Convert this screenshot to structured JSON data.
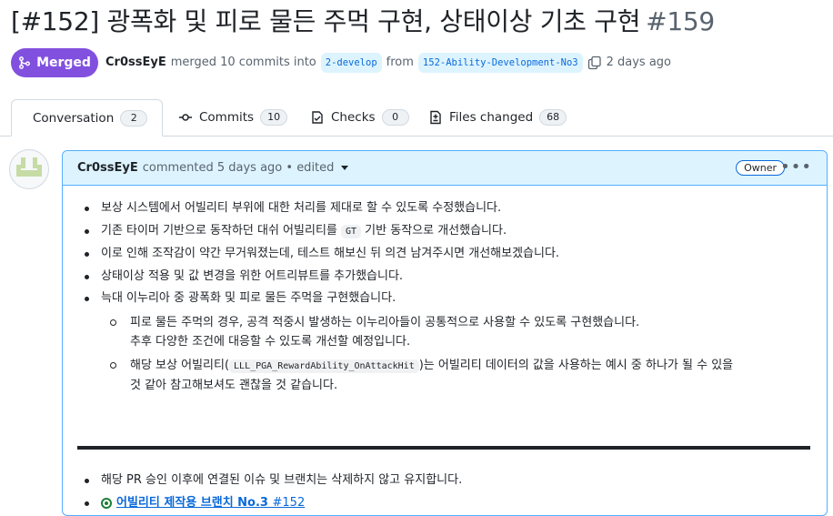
{
  "pr": {
    "title": "[#152] 광폭화 및 피로 물든 주먹 구현, 상태이상 기초 구현",
    "number": "#159",
    "state": "Merged",
    "author": "Cr0ssEyE",
    "merged_text": "merged 10 commits into",
    "base_branch": "2-develop",
    "from_text": "from",
    "head_branch": "152-Ability-Development-No3",
    "time": "2 days ago"
  },
  "tabs": [
    {
      "label": "Conversation",
      "count": "2",
      "icon": "comment-icon"
    },
    {
      "label": "Commits",
      "count": "10",
      "icon": "commit-icon"
    },
    {
      "label": "Checks",
      "count": "0",
      "icon": "checklist-icon"
    },
    {
      "label": "Files changed",
      "count": "68",
      "icon": "diff-icon"
    }
  ],
  "comment": {
    "author": "Cr0ssEyE",
    "meta": "commented 5 days ago • edited",
    "badge": "Owner",
    "items": [
      {
        "text": "보상 시스템에서 어빌리티 부위에 대한 처리를 제대로 할 수 있도록 수정했습니다."
      },
      {
        "pre": "기존 타이머 기반으로 동작하던 대쉬 어빌리티를 ",
        "code": "GT",
        "post": " 기반 동작으로 개선했습니다."
      },
      {
        "text": "이로 인해 조작감이 약간 무거워졌는데, 테스트 해보신 뒤 의견 남겨주시면 개선해보겠습니다."
      },
      {
        "text": "상태이상 적용 및 값 변경을 위한 어트리뷰트를 추가했습니다."
      },
      {
        "text": "늑대 이누리아 중 광폭화 및 피로 물든 주먹을 구현했습니다."
      }
    ],
    "sub_items": [
      {
        "line1": "피로 물든 주먹의 경우, 공격 적중시 발생하는 이누리아들이 공통적으로 사용할 수 있도록 구현했습니다.",
        "line2": "추후 다양한 조건에 대응할 수 있도록 개선할 예정입니다."
      },
      {
        "pre": "해당 보상 어빌리티(",
        "code": "LLL_PGA_RewardAbility_OnAttackHit",
        "post": ")는 어빌리티 데이터의 값을 사용하는 예시 중 하나가 될 수 있을",
        "line2": "것 같아 참고해보셔도 괜찮을 것 같습니다."
      }
    ],
    "footer_item": "해당 PR 승인 이후에 연결된 이슈 및 브랜치는 삭제하지 않고 유지합니다.",
    "linked_issue": {
      "title": "어빌리티 제작용 브랜치 No.3",
      "number": "#152"
    }
  }
}
